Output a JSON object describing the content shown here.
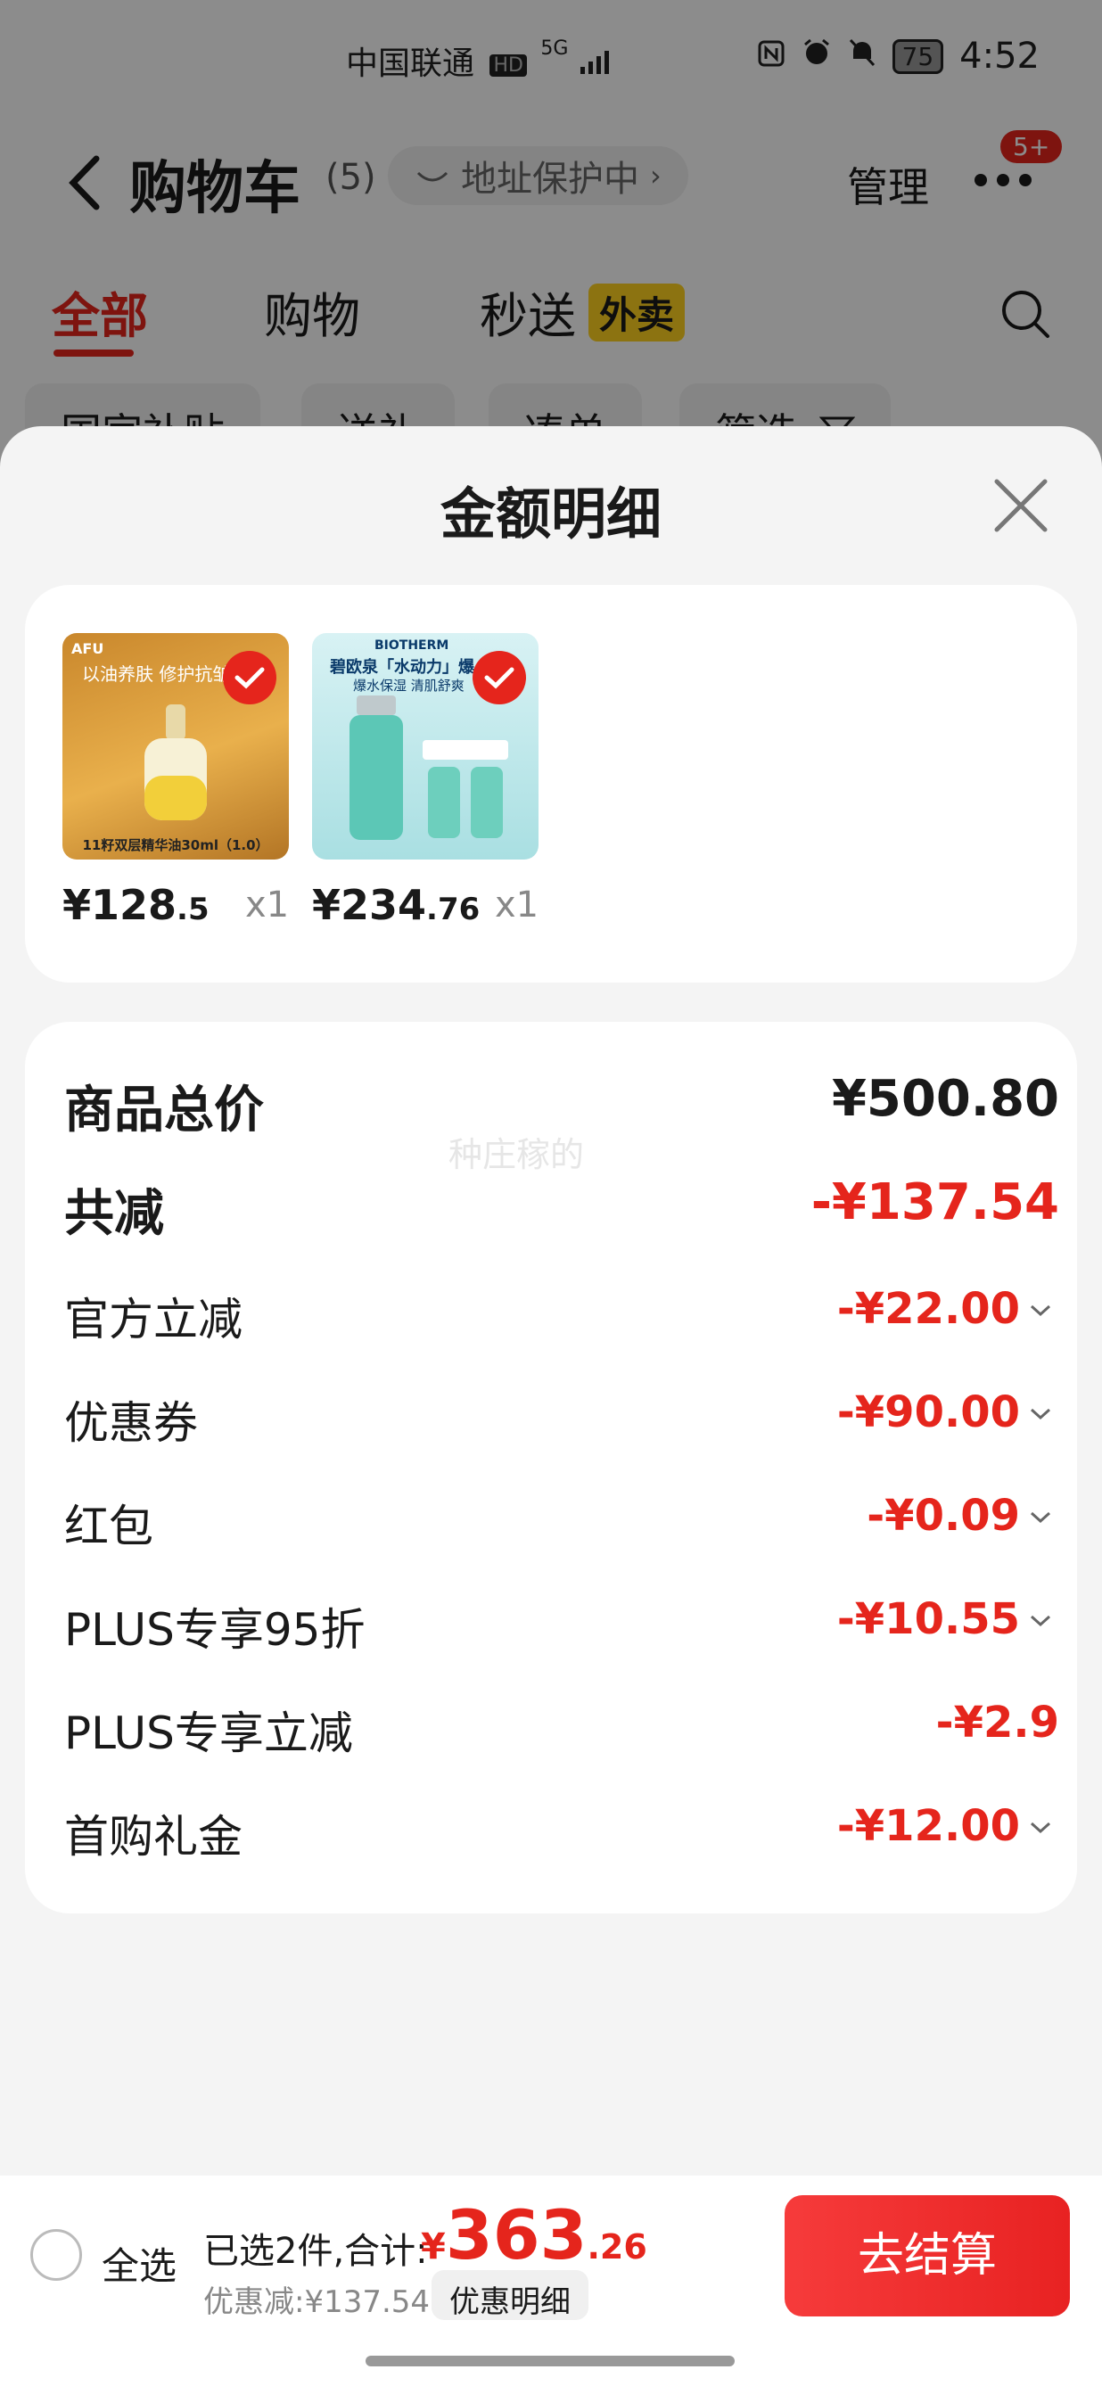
{
  "status_bar": {
    "carrier": "中国联通",
    "hd": "HD",
    "network": "5G",
    "battery": "75",
    "time": "4:52"
  },
  "nav": {
    "title": "购物车",
    "count": "(5)",
    "address_protection": "地址保护中",
    "manage": "管理",
    "more_badge": "5+"
  },
  "tabs": [
    {
      "label": "全部",
      "active": true
    },
    {
      "label": "购物"
    },
    {
      "label": "秒送"
    }
  ],
  "tab_tag": "外卖",
  "filters": [
    "国家补贴",
    "送礼",
    "凑单",
    "筛选"
  ],
  "sheet": {
    "title": "金额明细",
    "products": [
      {
        "name": "AFU 11籽双层精华油30ml",
        "thumb_text_top": "以油养肤 修护抗皱",
        "thumb_text_bottom": "11籽双层精华油30ml（1.0）",
        "brand": "AFU",
        "price_int": "¥128",
        "price_dec": ".5",
        "qty": "x1"
      },
      {
        "name": "碧欧泉 水动力 爆水",
        "thumb_text_top": "碧欧泉「水动力」爆",
        "thumb_text_bottom": "爆水保湿 清肌舒爽",
        "brand": "BIOTHERM",
        "price_int": "¥234",
        "price_dec": ".76",
        "qty": "x1"
      }
    ],
    "watermark": "种庄稼的",
    "summary": [
      {
        "label": "商品总价",
        "value": "¥500.80",
        "style": "big-black"
      },
      {
        "label": "共减",
        "value": "-¥137.54",
        "style": "big-red"
      },
      {
        "label": "官方立减",
        "value": "-¥22.00",
        "chevron": true
      },
      {
        "label": "优惠券",
        "value": "-¥90.00",
        "chevron": true
      },
      {
        "label": "红包",
        "value": "-¥0.09",
        "chevron": true
      },
      {
        "label": "PLUS专享95折",
        "value": "-¥10.55",
        "chevron": true
      },
      {
        "label": "PLUS专享立减",
        "value": "-¥2.9",
        "chevron": false
      },
      {
        "label": "首购礼金",
        "value": "-¥12.00",
        "chevron": true
      }
    ]
  },
  "bottom": {
    "select_all": "全选",
    "selected_text": "已选2件,合计:",
    "total_cur": "¥",
    "total_int": "363",
    "total_dec": ".26",
    "discount_text": "优惠减:¥137.54",
    "detail_button": "优惠明细",
    "checkout": "去结算"
  },
  "colors": {
    "accent": "#e5251c",
    "tag_yellow": "#ffd21f"
  }
}
